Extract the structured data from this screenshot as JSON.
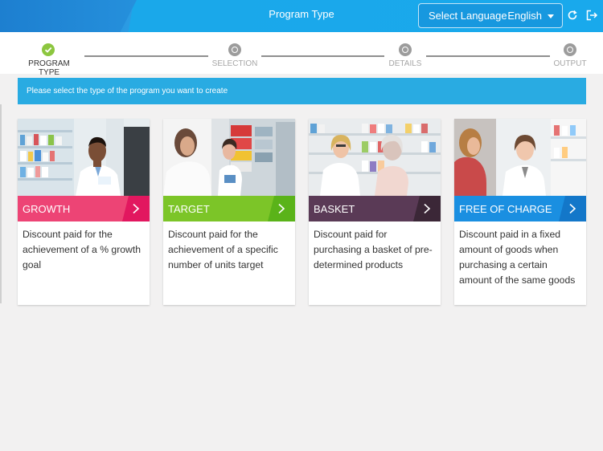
{
  "header": {
    "title": "Program Type",
    "language_label": "Select Language",
    "language_value": "English",
    "refresh_icon": "refresh-icon",
    "logout_icon": "logout-icon"
  },
  "wizard": {
    "steps": [
      {
        "label": "PROGRAM TYPE",
        "state": "done"
      },
      {
        "label": "SELECTION",
        "state": "pending"
      },
      {
        "label": "DETAILS",
        "state": "pending"
      },
      {
        "label": "OUTPUT",
        "state": "pending"
      }
    ]
  },
  "banner": {
    "text": "Please select the type of the program you want to create"
  },
  "cards": [
    {
      "title": "GROWTH",
      "color": "#e2175f",
      "bar_color": "#ed4475",
      "description": "Discount paid for the achievement of a % growth goal"
    },
    {
      "title": "TARGET",
      "color": "#5ab319",
      "bar_color": "#7cc528",
      "description": "Discount paid for the achievement of a specific number of units target"
    },
    {
      "title": "BASKET",
      "color": "#3b2737",
      "bar_color": "#5a3a56",
      "description": "Discount paid for purchasing a basket of pre-determined products"
    },
    {
      "title": "FREE OF CHARGE",
      "color": "#1377c9",
      "bar_color": "#1a8fe1",
      "description": "Discount paid in a fixed amount of goods when purchasing a certain amount of the same goods"
    }
  ],
  "colors": {
    "header": "#1aa8ea",
    "banner": "#29abe2",
    "step_done": "#8cc63f",
    "step_pending": "#9c9c9c"
  }
}
